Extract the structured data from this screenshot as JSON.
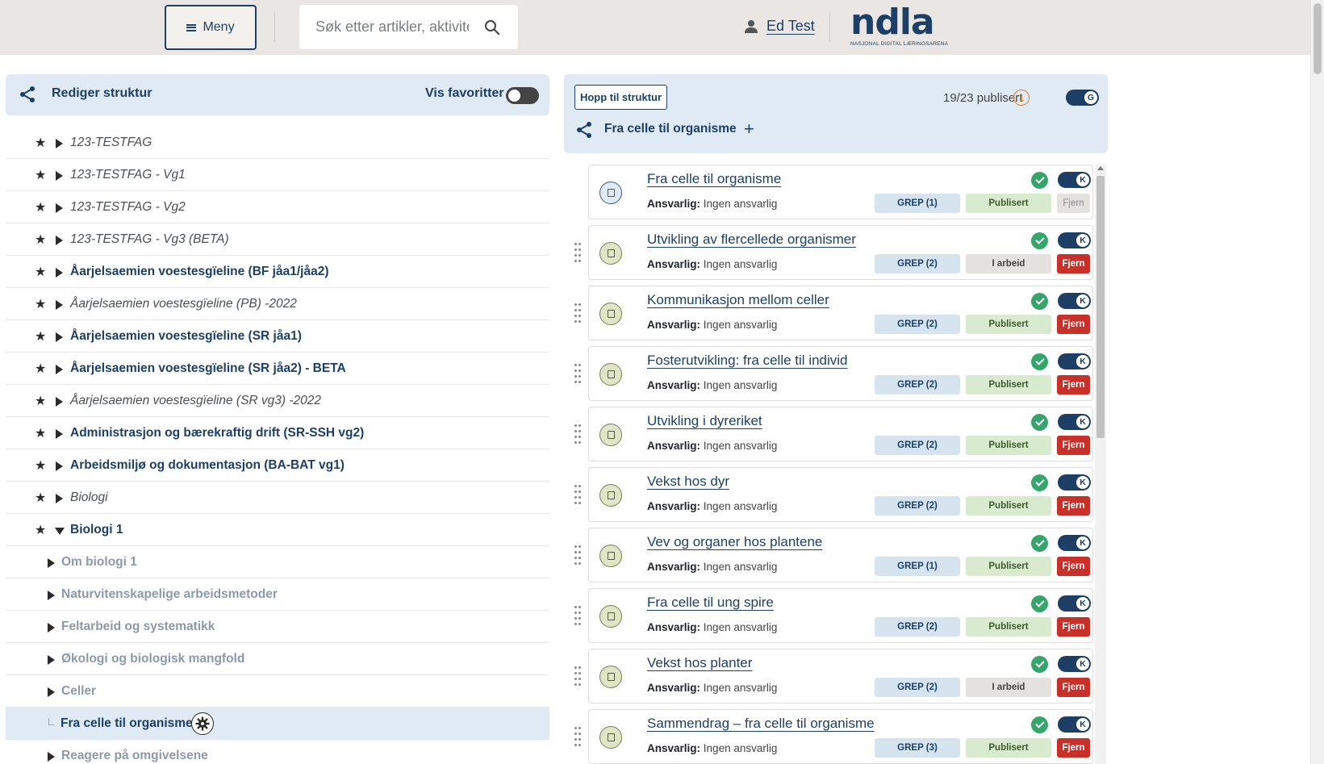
{
  "header": {
    "menu_label": "Meny",
    "search_placeholder": "Søk etter artikler, aktiviteter eller oppgaver",
    "user_name": "Ed Test",
    "logo_text": "ndla",
    "logo_subtitle": "NASJONAL DIGITAL LÆRINGSARENA"
  },
  "structure": {
    "title": "Rediger struktur",
    "favorites_label": "Vis favoritter",
    "favorites_on": false,
    "items": [
      {
        "label": "123-TESTFAG",
        "style": "italic",
        "level": 0,
        "expanded": false
      },
      {
        "label": "123-TESTFAG - Vg1",
        "style": "italic",
        "level": 0,
        "expanded": false
      },
      {
        "label": "123-TESTFAG - Vg2",
        "style": "italic",
        "level": 0,
        "expanded": false
      },
      {
        "label": "123-TESTFAG - Vg3 (BETA)",
        "style": "italic",
        "level": 0,
        "expanded": false
      },
      {
        "label": "Åarjelsaemien voestesgïeline (BF jåa1/jåa2)",
        "style": "bold",
        "level": 0,
        "expanded": false
      },
      {
        "label": "Åarjelsaemien voestesgïeline (PB) -2022",
        "style": "italic",
        "level": 0,
        "expanded": false
      },
      {
        "label": "Åarjelsaemien voestesgïeline (SR jåa1)",
        "style": "bold",
        "level": 0,
        "expanded": false
      },
      {
        "label": "Åarjelsaemien voestesgïeline (SR jåa2) - BETA",
        "style": "bold",
        "level": 0,
        "expanded": false
      },
      {
        "label": "Åarjelsaemien voestesgïeline (SR vg3) -2022",
        "style": "italic",
        "level": 0,
        "expanded": false
      },
      {
        "label": "Administrasjon og bærekraftig drift (SR-SSH vg2)",
        "style": "bold",
        "level": 0,
        "expanded": false
      },
      {
        "label": "Arbeidsmiljø og dokumentasjon (BA-BAT vg1)",
        "style": "bold",
        "level": 0,
        "expanded": false
      },
      {
        "label": "Biologi",
        "style": "italic",
        "level": 0,
        "expanded": false
      },
      {
        "label": "Biologi 1",
        "style": "bold",
        "level": 0,
        "expanded": true
      },
      {
        "label": "Om biologi 1",
        "style": "child",
        "level": 1,
        "expanded": false
      },
      {
        "label": "Naturvitenskapelige arbeidsmetoder",
        "style": "child",
        "level": 1,
        "expanded": false
      },
      {
        "label": "Feltarbeid og systematikk",
        "style": "child",
        "level": 1,
        "expanded": false
      },
      {
        "label": "Økologi og biologisk mangfold",
        "style": "child",
        "level": 1,
        "expanded": false
      },
      {
        "label": "Celler",
        "style": "child",
        "level": 1,
        "expanded": false
      },
      {
        "label": "Fra celle til organisme",
        "style": "selected",
        "level": 1,
        "expanded": false
      },
      {
        "label": "Reagere på omgivelsene",
        "style": "child",
        "level": 1,
        "expanded": false
      }
    ]
  },
  "topic": {
    "jump_label": "Hopp til struktur",
    "publish_count": "19/23 publisert",
    "warning_count": "1",
    "grep_toggle_letter": "G",
    "node_name": "Fra celle til organisme",
    "add_label": "+"
  },
  "resources": {
    "responsible_label": "Ansvarlig:",
    "items": [
      {
        "title": "Fra celle til organisme",
        "responsible": "Ingen ansvarlig",
        "grep": "GREP (1)",
        "status": "Publisert",
        "remove": "Fjern",
        "type": "topic",
        "toggle": "K",
        "removable": false
      },
      {
        "title": "Utvikling av flercellede organismer",
        "responsible": "Ingen ansvarlig",
        "grep": "GREP (2)",
        "status": "I arbeid",
        "remove": "Fjern",
        "type": "resource",
        "toggle": "K",
        "removable": true
      },
      {
        "title": "Kommunikasjon mellom celler",
        "responsible": "Ingen ansvarlig",
        "grep": "GREP (2)",
        "status": "Publisert",
        "remove": "Fjern",
        "type": "resource",
        "toggle": "K",
        "removable": true
      },
      {
        "title": "Fosterutvikling: fra celle til individ",
        "responsible": "Ingen ansvarlig",
        "grep": "GREP (2)",
        "status": "Publisert",
        "remove": "Fjern",
        "type": "resource",
        "toggle": "K",
        "removable": true
      },
      {
        "title": "Utvikling i dyreriket",
        "responsible": "Ingen ansvarlig",
        "grep": "GREP (2)",
        "status": "Publisert",
        "remove": "Fjern",
        "type": "resource",
        "toggle": "K",
        "removable": true
      },
      {
        "title": "Vekst hos dyr",
        "responsible": "Ingen ansvarlig",
        "grep": "GREP (2)",
        "status": "Publisert",
        "remove": "Fjern",
        "type": "resource",
        "toggle": "K",
        "removable": true
      },
      {
        "title": "Vev og organer hos plantene",
        "responsible": "Ingen ansvarlig",
        "grep": "GREP (1)",
        "status": "Publisert",
        "remove": "Fjern",
        "type": "resource",
        "toggle": "K",
        "removable": true
      },
      {
        "title": "Fra celle til ung spire",
        "responsible": "Ingen ansvarlig",
        "grep": "GREP (2)",
        "status": "Publisert",
        "remove": "Fjern",
        "type": "resource",
        "toggle": "K",
        "removable": true
      },
      {
        "title": "Vekst hos planter",
        "responsible": "Ingen ansvarlig",
        "grep": "GREP (2)",
        "status": "I arbeid",
        "remove": "Fjern",
        "type": "resource",
        "toggle": "K",
        "removable": true
      },
      {
        "title": "Sammendrag – fra celle til organisme",
        "responsible": "Ingen ansvarlig",
        "grep": "GREP (3)",
        "status": "Publisert",
        "remove": "Fjern",
        "type": "resource",
        "toggle": "K",
        "removable": true
      }
    ]
  },
  "colors": {
    "brand": "#1d3f66",
    "panel": "#dfeaf5",
    "success": "#36a56b",
    "danger": "#c8302a",
    "warning": "#d9822b"
  }
}
